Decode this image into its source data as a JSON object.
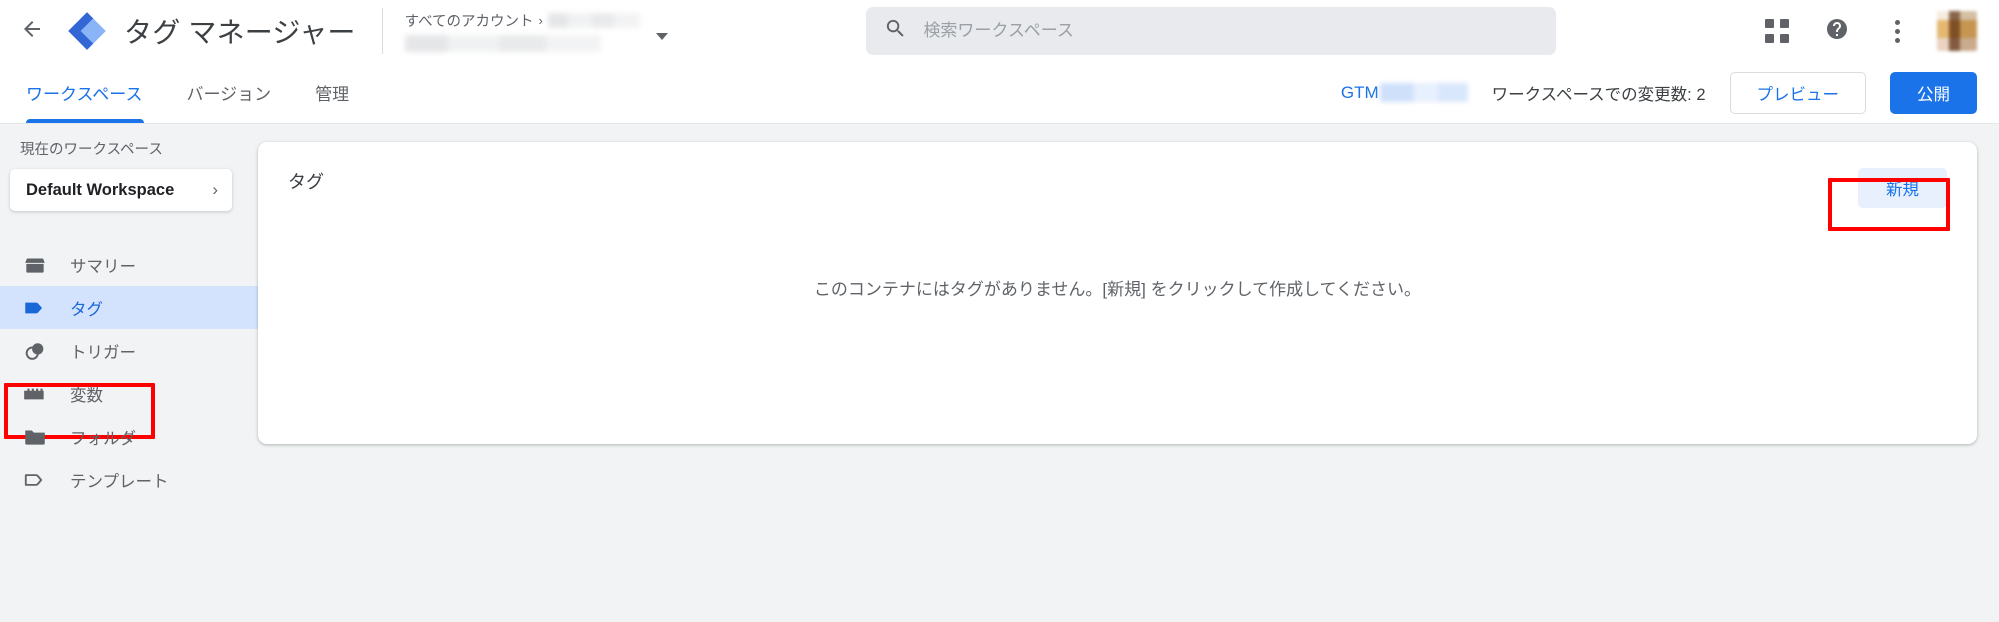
{
  "header": {
    "back_icon": "arrow-back-icon",
    "logo_icon": "tag-manager-logo",
    "product_title": "タグ マネージャー",
    "account_picker": {
      "all_accounts_label": "すべてのアカウント",
      "separator": "›",
      "account_name_redacted": "",
      "container_name_redacted": ""
    },
    "search": {
      "icon": "search-icon",
      "placeholder": "検索ワークスペース",
      "value": ""
    },
    "actions": {
      "apps_icon": "apps-grid-icon",
      "help_icon": "help-circle-icon",
      "more_icon": "more-vert-icon",
      "avatar": "user-avatar"
    }
  },
  "tabbar": {
    "tabs": [
      {
        "label": "ワークスペース",
        "active": true
      },
      {
        "label": "バージョン",
        "active": false
      },
      {
        "label": "管理",
        "active": false
      }
    ],
    "container_id_prefix": "GTM",
    "container_id_redacted": "",
    "changes_text": "ワークスペースでの変更数: 2",
    "preview_label": "プレビュー",
    "publish_label": "公開"
  },
  "sidebar": {
    "current_workspace_label": "現在のワークスペース",
    "workspace_name": "Default Workspace",
    "workspace_chevron": "›",
    "items": [
      {
        "label": "サマリー",
        "icon": "container-box-icon",
        "selected": false
      },
      {
        "label": "タグ",
        "icon": "tag-icon",
        "selected": true
      },
      {
        "label": "トリガー",
        "icon": "trigger-circles-icon",
        "selected": false
      },
      {
        "label": "変数",
        "icon": "variable-blocks-icon",
        "selected": false
      },
      {
        "label": "フォルダ",
        "icon": "folder-icon",
        "selected": false
      },
      {
        "label": "テンプレート",
        "icon": "template-tag-icon",
        "selected": false
      }
    ]
  },
  "main": {
    "card_title": "タグ",
    "new_button_label": "新規",
    "empty_message": "このコンテナにはタグがありません。[新規] をクリックして作成してください。"
  },
  "annotations": {
    "accent_color": "#ff0000",
    "boxes": [
      {
        "target": "sidebar-item-tag"
      },
      {
        "target": "new-tag-button"
      }
    ]
  },
  "colors": {
    "brand_blue": "#1a73e8",
    "selected_nav_bg": "#d3e3fd",
    "new_button_bg": "#e8f0fe",
    "page_bg": "#f1f3f4",
    "annotation_red": "#ff0000"
  }
}
